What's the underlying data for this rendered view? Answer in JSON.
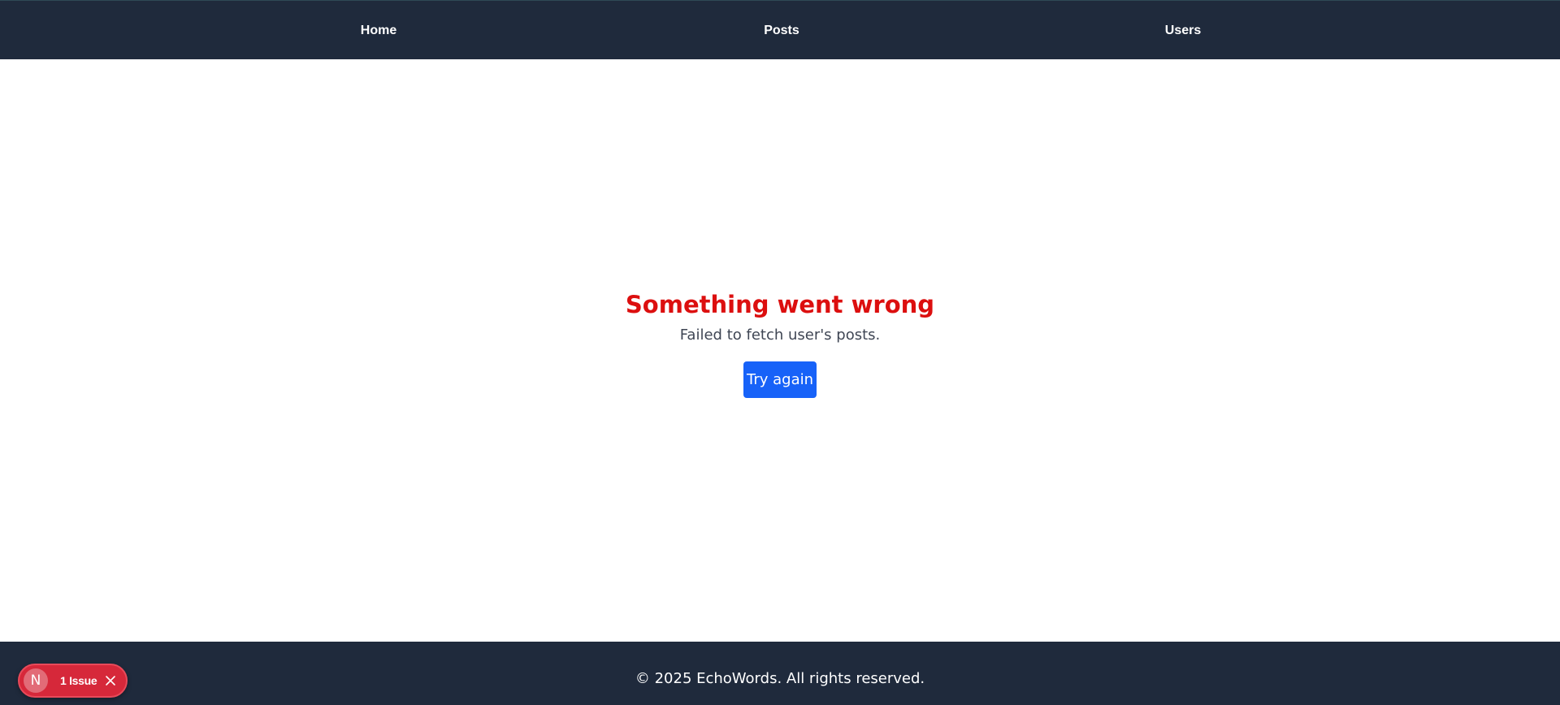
{
  "nav": {
    "items": [
      {
        "label": "Home"
      },
      {
        "label": "Posts"
      },
      {
        "label": "Users"
      }
    ]
  },
  "error": {
    "title": "Something went wrong",
    "message": "Failed to fetch user's posts.",
    "retry_label": "Try again"
  },
  "footer": {
    "text": "© 2025 EchoWords. All rights reserved."
  },
  "dev_indicator": {
    "logo_letter": "N",
    "label": "1 Issue"
  },
  "colors": {
    "nav_background": "#1f2a3c",
    "error_title": "#dc0f0f",
    "button_background": "#1762f8",
    "issue_pill": "#d6283a"
  }
}
